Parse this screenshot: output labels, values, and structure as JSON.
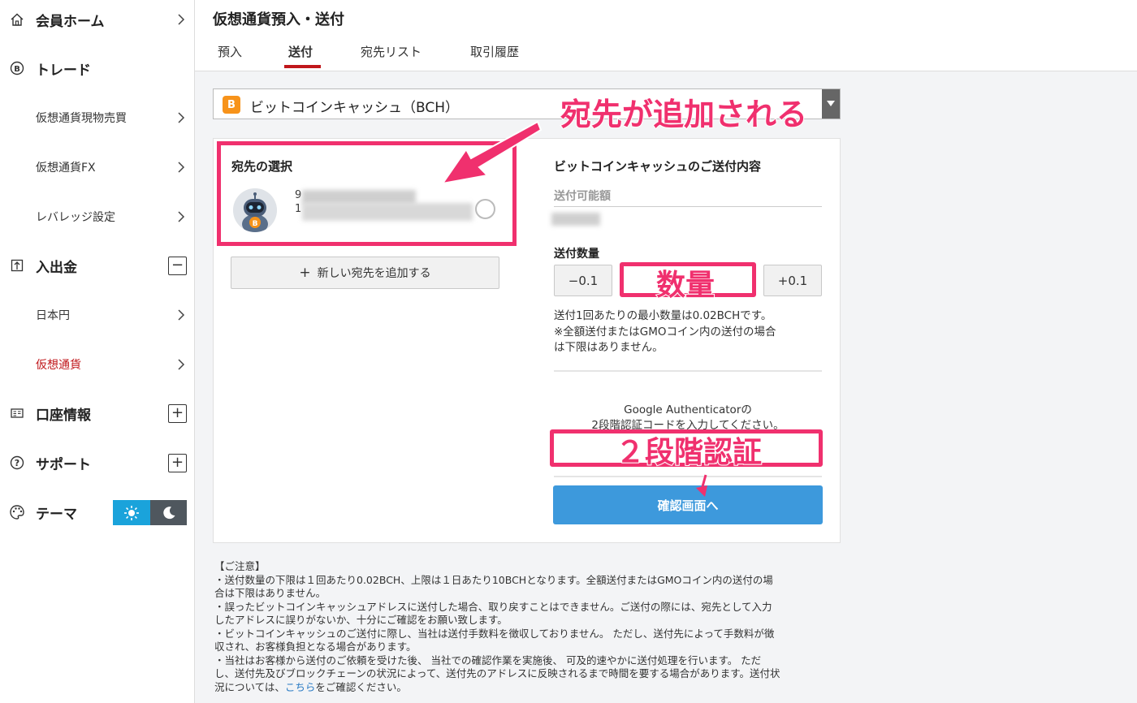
{
  "sidebar": {
    "items": [
      {
        "label": "会員ホーム",
        "icon": "home-icon"
      },
      {
        "label": "トレード",
        "icon": "bitcoin-circle-icon"
      },
      {
        "label": "仮想通貨現物売買"
      },
      {
        "label": "仮想通貨FX"
      },
      {
        "label": "レバレッジ設定"
      },
      {
        "label": "入出金",
        "icon": "deposit-icon",
        "toggle": "−"
      },
      {
        "label": "日本円"
      },
      {
        "label": "仮想通貨"
      },
      {
        "label": "口座情報",
        "icon": "account-icon",
        "toggle": "+"
      },
      {
        "label": "サポート",
        "icon": "help-icon",
        "toggle": "+"
      },
      {
        "label": "テーマ",
        "icon": "palette-icon"
      }
    ],
    "active_color": "#c0171b"
  },
  "header": {
    "title": "仮想通貨預入・送付",
    "tabs": [
      {
        "label": "預入"
      },
      {
        "label": "送付"
      },
      {
        "label": "宛先リスト"
      },
      {
        "label": "取引履歴"
      }
    ],
    "active_tab": "送付"
  },
  "currency_select": {
    "value": "ビットコインキャッシュ（BCH）",
    "coin_symbol": "B"
  },
  "destination": {
    "title": "宛先の選択",
    "address_prefix_1": "9",
    "address_prefix_2": "1",
    "add_button": "新しい宛先を追加する",
    "add_icon": "+"
  },
  "send_panel": {
    "title": "ビットコインキャッシュのご送付内容",
    "available_label": "送付可能額",
    "quantity_label": "送付数量",
    "minus_button": "−0.1",
    "plus_button": "+0.1",
    "note_lines": [
      "送付1回あたりの最小数量は0.02BCHです。",
      "※全額送付またはGMOコイン内の送付の場合",
      "は下限はありません。"
    ],
    "auth_lines": [
      "Google Authenticatorの",
      "2段階認証コードを入力してください。"
    ],
    "confirm_button": "確認画面へ",
    "confirm_color": "#3d99dc"
  },
  "annotations": {
    "dest_added": "宛先が追加される",
    "quantity": "数量",
    "two_factor": "２段階認証",
    "color": "#f0306e"
  },
  "notice": {
    "title": "【ご注意】",
    "lines": [
      "・送付数量の下限は１回あたり0.02BCH、上限は１日あたり10BCHとなります。全額送付またはGMOコイン内の送付の場",
      "合は下限はありません。",
      "・誤ったビットコインキャッシュアドレスに送付した場合、取り戻すことはできません。ご送付の際には、宛先として入力",
      "したアドレスに誤りがないか、十分にご確認をお願い致します。",
      "・ビットコインキャッシュのご送付に際し、当社は送付手数料を徴収しておりません。 ただし、送付先によって手数料が徴",
      "収され、お客様負担となる場合があります。",
      "・当社はお客様から送付のご依頼を受けた後、 当社での確認作業を実施後、 可及的速やかに送付処理を行います。 ただ",
      "し、送付先及びブロックチェーンの状況によって、送付先のアドレスに反映されるまで時間を要する場合があります。送付状"
    ],
    "last_line_before": "況については、",
    "link": "こちら",
    "last_line_after": "をご確認ください。"
  }
}
